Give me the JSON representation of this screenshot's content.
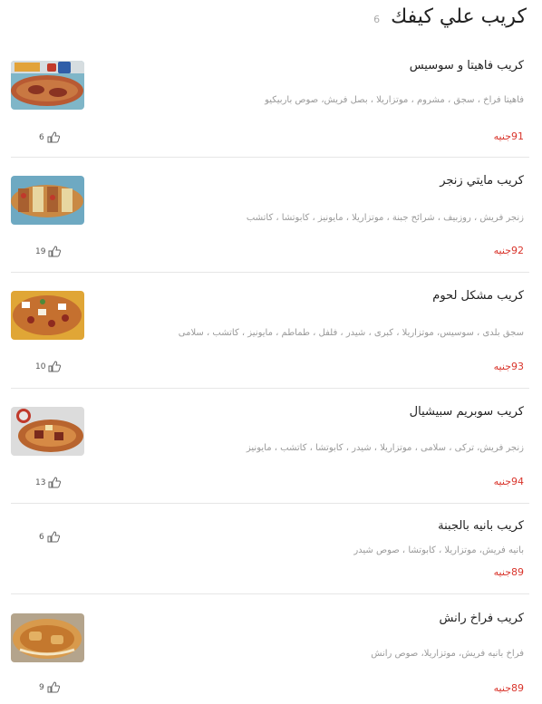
{
  "category": {
    "title": "كريب علي كيفك",
    "count": "6"
  },
  "currency": "جنيه",
  "items": [
    {
      "name": "كريب فاهيتا و سوسيس",
      "description": "فاهيتا فراخ ، سجق ، مشروم ، موتزاريلا ، بصل فريش، صوص باربيكيو",
      "price": "91",
      "likes": "6",
      "photo": "crepe-fajita-photo"
    },
    {
      "name": "كريب مايتي زنجر",
      "description": "زنجر فريش ، روزبيف ، شرائح جبنة ، موتزاريلا ، مايونيز ، كابوتشا ، كاتشب",
      "price": "92",
      "likes": "19",
      "photo": "crepe-zinger-photo"
    },
    {
      "name": "كريب مشكل لحوم",
      "description": "سجق بلدى ، سوسيس، موتزاريلا ، كبرى ، شيدر ، فلفل ، طماطم ، مايونيز ، كاتشب ، سلامى",
      "price": "93",
      "likes": "10",
      "photo": "crepe-mixed-meat-photo"
    },
    {
      "name": "كريب سوبريم سبيشيال",
      "description": "زنجر فريش، تركى ، سلامى ، موتزاريلا ، شيدر ، كابوتشا ، كاتشب ، مايونيز",
      "price": "94",
      "likes": "13",
      "photo": "crepe-supreme-photo"
    },
    {
      "name": "كريب بانيه بالجبنة",
      "description": "بانيه فريش، موتزاريلا ، كابوتشا ، صوص شيدر",
      "price": "89",
      "likes": "6",
      "photo": ""
    },
    {
      "name": "كريب فراخ رانش",
      "description": "فراخ بانيه فريش، موتزاريلا، صوص رانش",
      "price": "89",
      "likes": "9",
      "photo": "crepe-ranch-photo"
    }
  ]
}
